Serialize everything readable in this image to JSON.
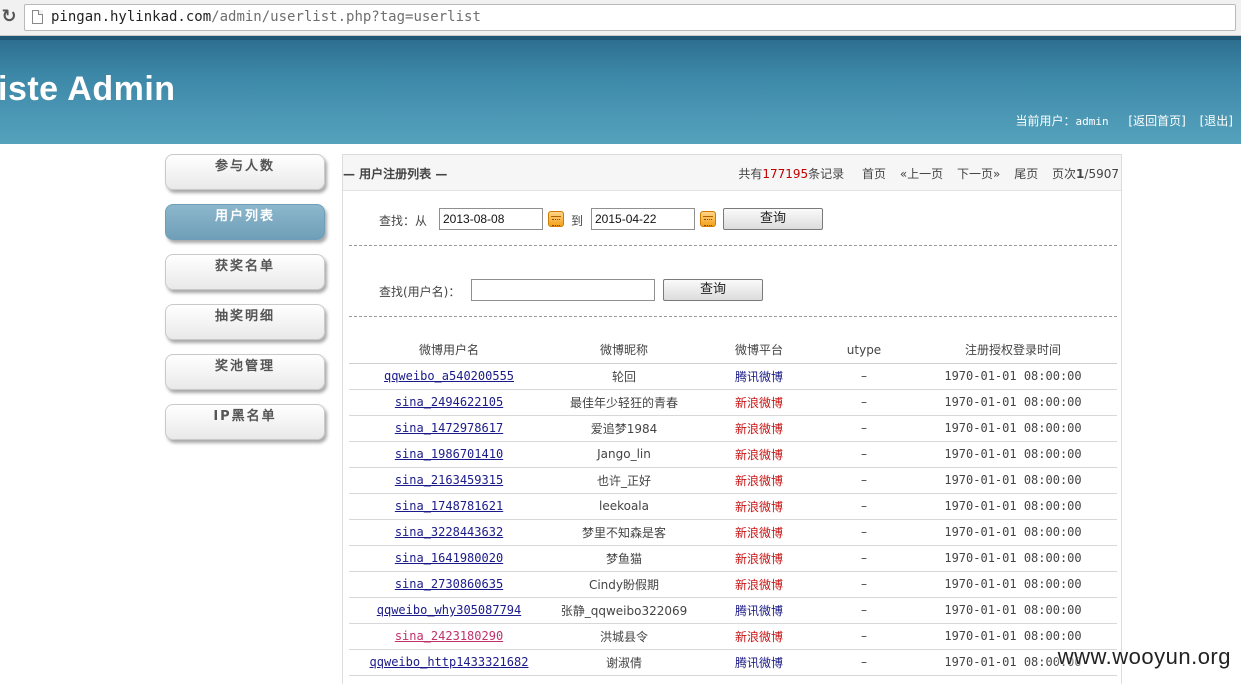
{
  "browser": {
    "url_domain": "pingan.hylinkad.com",
    "url_path": "/admin/userlist.php?tag=userlist"
  },
  "header": {
    "brand": "iste Admin",
    "current_user_label": "当前用户：",
    "current_user": "admin",
    "home_link": "[返回首页]",
    "logout_link": "[退出]"
  },
  "sidebar": {
    "items": [
      {
        "label": "参与人数"
      },
      {
        "label": "用户列表"
      },
      {
        "label": "获奖名单"
      },
      {
        "label": "抽奖明细"
      },
      {
        "label": "奖池管理"
      },
      {
        "label": "IP黑名单"
      }
    ],
    "active_index": 1
  },
  "panel": {
    "title": "— 用户注册列表 —",
    "pager": {
      "total_prefix": "共有",
      "total": "177195",
      "total_suffix": "条记录",
      "first": "首页",
      "prev": "«上一页",
      "next": "下一页»",
      "last": "尾页",
      "page_prefix": "页次",
      "page_current": "1",
      "page_total": "/5907"
    }
  },
  "date_search": {
    "label_find": "查找：",
    "label_from": "从",
    "from_value": "2013-08-08",
    "label_to": "到",
    "to_value": "2015-04-22",
    "button": "查询"
  },
  "name_search": {
    "label": "查找(用户名)：",
    "value": "",
    "button": "查询"
  },
  "table": {
    "columns": [
      "微博用户名",
      "微博昵称",
      "微博平台",
      "utype",
      "注册授权登录时间"
    ],
    "rows": [
      {
        "username": "qqweibo_a540200555",
        "nickname": "轮回",
        "platform": "腾讯微博",
        "utype": "–",
        "time": "1970-01-01 08:00:00"
      },
      {
        "username": "sina_2494622105",
        "nickname": "最佳年少轻狂的青春",
        "platform": "新浪微博",
        "utype": "–",
        "time": "1970-01-01 08:00:00"
      },
      {
        "username": "sina_1472978617",
        "nickname": "爱追梦1984",
        "platform": "新浪微博",
        "utype": "–",
        "time": "1970-01-01 08:00:00"
      },
      {
        "username": "sina_1986701410",
        "nickname": "Jango_lin",
        "platform": "新浪微博",
        "utype": "–",
        "time": "1970-01-01 08:00:00"
      },
      {
        "username": "sina_2163459315",
        "nickname": "也许_正好",
        "platform": "新浪微博",
        "utype": "–",
        "time": "1970-01-01 08:00:00"
      },
      {
        "username": "sina_1748781621",
        "nickname": "leekoala",
        "platform": "新浪微博",
        "utype": "–",
        "time": "1970-01-01 08:00:00"
      },
      {
        "username": "sina_3228443632",
        "nickname": "梦里不知森是客",
        "platform": "新浪微博",
        "utype": "–",
        "time": "1970-01-01 08:00:00"
      },
      {
        "username": "sina_1641980020",
        "nickname": "梦鱼猫",
        "platform": "新浪微博",
        "utype": "–",
        "time": "1970-01-01 08:00:00"
      },
      {
        "username": "sina_2730860635",
        "nickname": "Cindy盼假期",
        "platform": "新浪微博",
        "utype": "–",
        "time": "1970-01-01 08:00:00"
      },
      {
        "username": "qqweibo_why305087794",
        "nickname": "张静_qqweibo322069",
        "platform": "腾讯微博",
        "utype": "–",
        "time": "1970-01-01 08:00:00"
      },
      {
        "username": "sina_2423180290",
        "nickname": "洪城县令",
        "platform": "新浪微博",
        "utype": "–",
        "time": "1970-01-01 08:00:00"
      },
      {
        "username": "qqweibo_http1433321682",
        "nickname": "谢淑倩",
        "platform": "腾讯微博",
        "utype": "–",
        "time": "1970-01-01 08:00:00"
      }
    ]
  },
  "watermark": "www.wooyun.org"
}
